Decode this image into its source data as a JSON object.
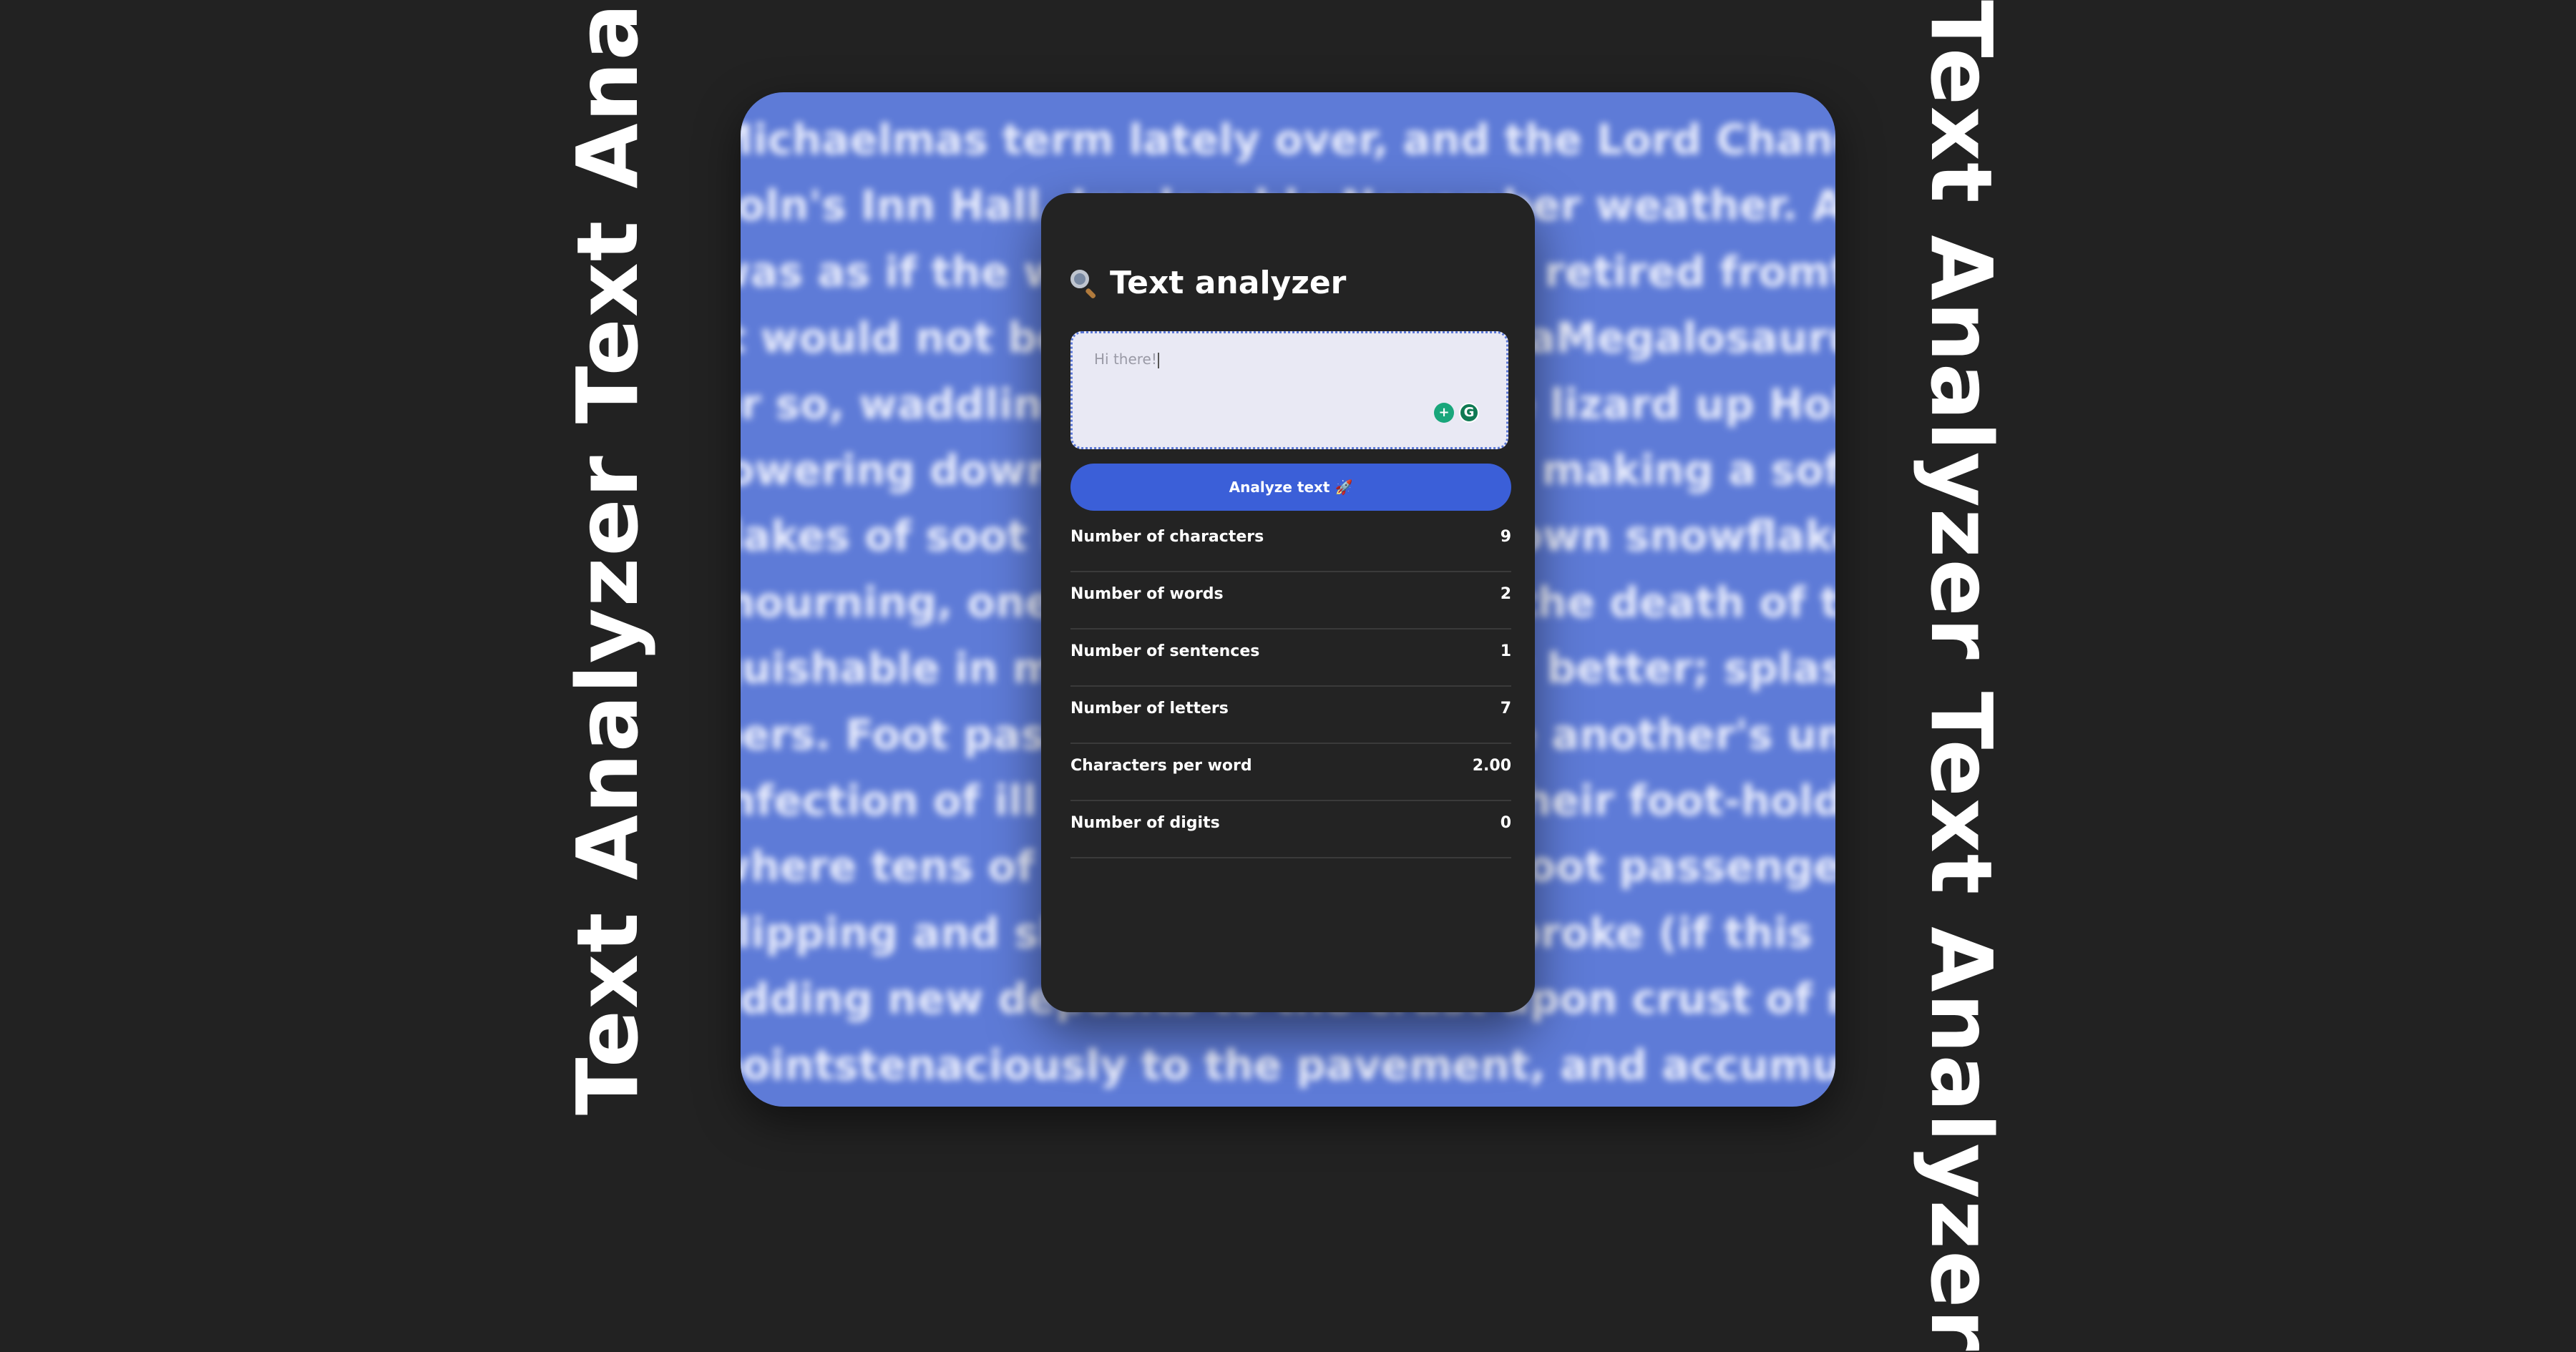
{
  "decor": {
    "left_text": "Text Analyzer   Text Analyzer",
    "right_text": "Text Analyzer   Text Analyzer"
  },
  "background_text": [
    "Michaelmas term lately over, and the Lord Chancellor",
    "coln's Inn Hall. Implacable November weather. As much",
    "was as if the waters had but newly retired fromthe face",
    "it would not be wonderful to meet aMegalosaurus",
    "or so, waddling like an elephantine lizard up Holborn",
    "lowering down from chimney-pots, making a soft black",
    "flakes of soot in it as big as full-grown snowflakes",
    "mourning, one might imagine, for the death of the sun.",
    "guishable in mire. Horses, scarcely better; splashed",
    "bers. Foot passengers, jostling one another's umbrellas",
    "infection of ill temper, and losing their foot-hold",
    "where tens of thousands of other foot passengers",
    "slipping and sliding since the day broke (if this",
    "adding new deposits to the crust upon crust of mud",
    "pointstenaciously to the pavement, and accumulating"
  ],
  "app": {
    "title": "Text analyzer",
    "input_value": "Hi there!",
    "analyze_button": "Analyze text 🚀"
  },
  "stats": [
    {
      "label": "Number of characters",
      "value": "9"
    },
    {
      "label": "Number of words",
      "value": "2"
    },
    {
      "label": "Number of sentences",
      "value": "1"
    },
    {
      "label": "Number of letters",
      "value": "7"
    },
    {
      "label": "Characters per word",
      "value": "2.00"
    },
    {
      "label": "Number of digits",
      "value": "0"
    }
  ],
  "colors": {
    "page_bg": "#222222",
    "panel_bg": "#5e7bd7",
    "card_bg": "#232323",
    "accent": "#3b5fd8",
    "input_bg": "#e9e9f4"
  },
  "icons": {
    "title_icon": "magnifying-glass-icon",
    "extension_1": "grammar-assist-icon",
    "extension_2": "grammarly-icon"
  }
}
